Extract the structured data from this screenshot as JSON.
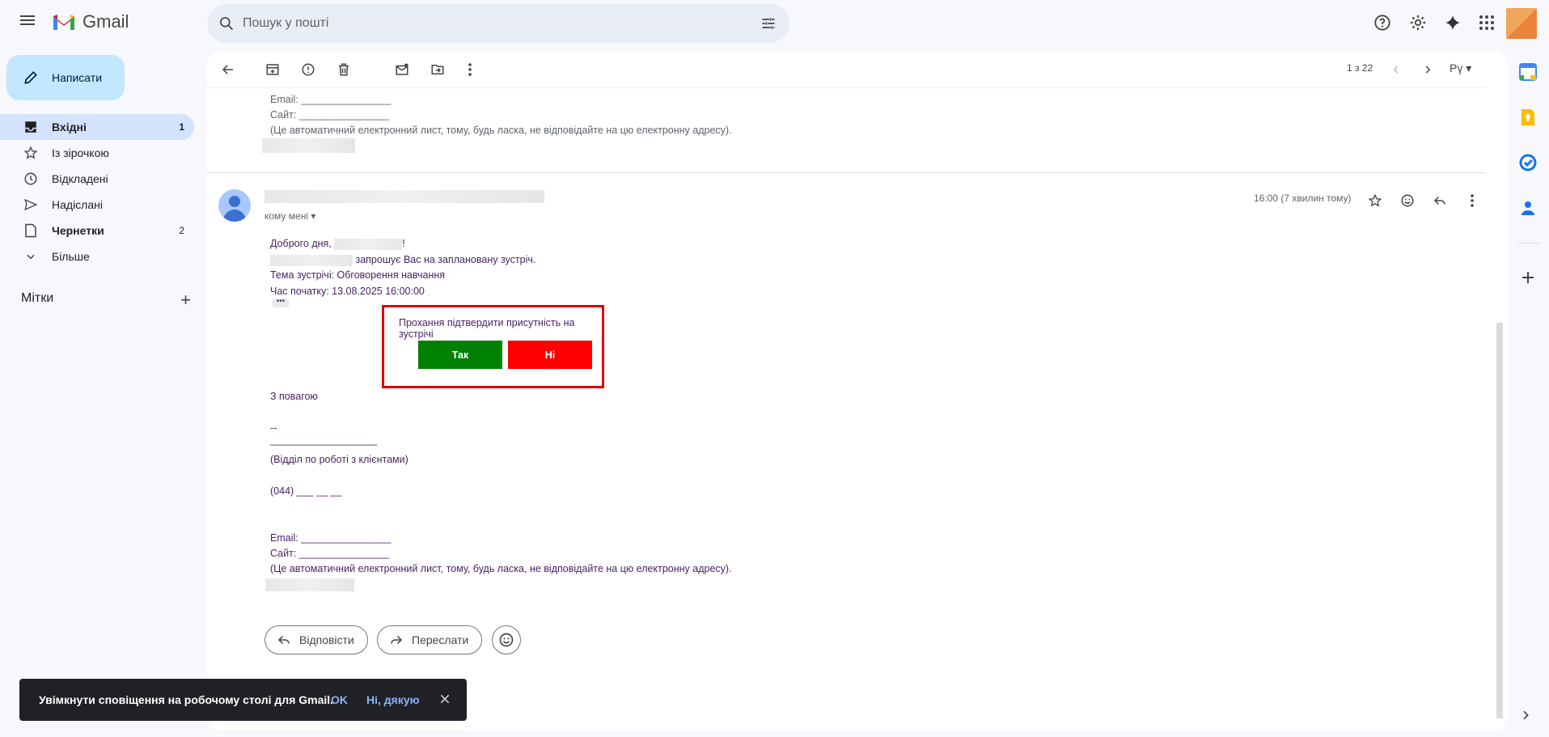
{
  "app": {
    "name": "Gmail"
  },
  "search": {
    "placeholder": "Пошук у пошті"
  },
  "compose": {
    "label": "Написати"
  },
  "nav": [
    {
      "label": "Вхідні",
      "count": "1",
      "icon": "inbox-icon"
    },
    {
      "label": "Із зірочкою",
      "count": "",
      "icon": "star-icon"
    },
    {
      "label": "Відкладені",
      "count": "",
      "icon": "clock-icon"
    },
    {
      "label": "Надіслані",
      "count": "",
      "icon": "send-icon"
    },
    {
      "label": "Чернетки",
      "count": "2",
      "icon": "draft-icon"
    },
    {
      "label": "Більше",
      "count": "",
      "icon": "chevron-down-icon"
    }
  ],
  "labels": {
    "title": "Мітки",
    "add": "+"
  },
  "toolbar": {
    "pager": "1 з 22",
    "lang": "Рү"
  },
  "prev_message": {
    "email_line": "Email: ________________",
    "site_line": "Сайт: ________________",
    "note": "(Це автоматичний електронний лист, тому, будь ласка, не відповідайте на цю електронну адресу)."
  },
  "message": {
    "to_me": "кому мені",
    "time": "16:00 (7 хвилин тому)",
    "greeting": "Доброго дня,",
    "greeting_end": "!",
    "invite": "запрошує Вас на заплановану зустріч.",
    "topic": "Тема зустрічі: Обговорення навчання",
    "start": "Час початку: 13.08.2025 16:00:00",
    "ellipsis": "•••",
    "confirm_title": "Прохання підтвердити присутність на зустрічі",
    "yes": "Так",
    "no": "Ні",
    "regards": "З повагою",
    "dashes": "--",
    "line": "___________________",
    "department": "(Відділ по роботі з клієнтами)",
    "phone": "(044) ___ __ __",
    "email_line": "Email: ________________",
    "site_line": "Сайт: ________________",
    "note": "(Це автоматичний електронний лист, тому, будь ласка, не відповідайте на цю електронну адресу)."
  },
  "actions": {
    "reply": "Відповісти",
    "forward": "Переслати"
  },
  "snackbar": {
    "text": "Увімкнути сповіщення на робочому столі для Gmail.",
    "ok": "OK",
    "no_thanks": "Ні, дякую"
  },
  "colors": {
    "yes": "#008000",
    "no": "#ff0000",
    "highlight_border": "#e00000",
    "body_text": "#4a2266"
  }
}
